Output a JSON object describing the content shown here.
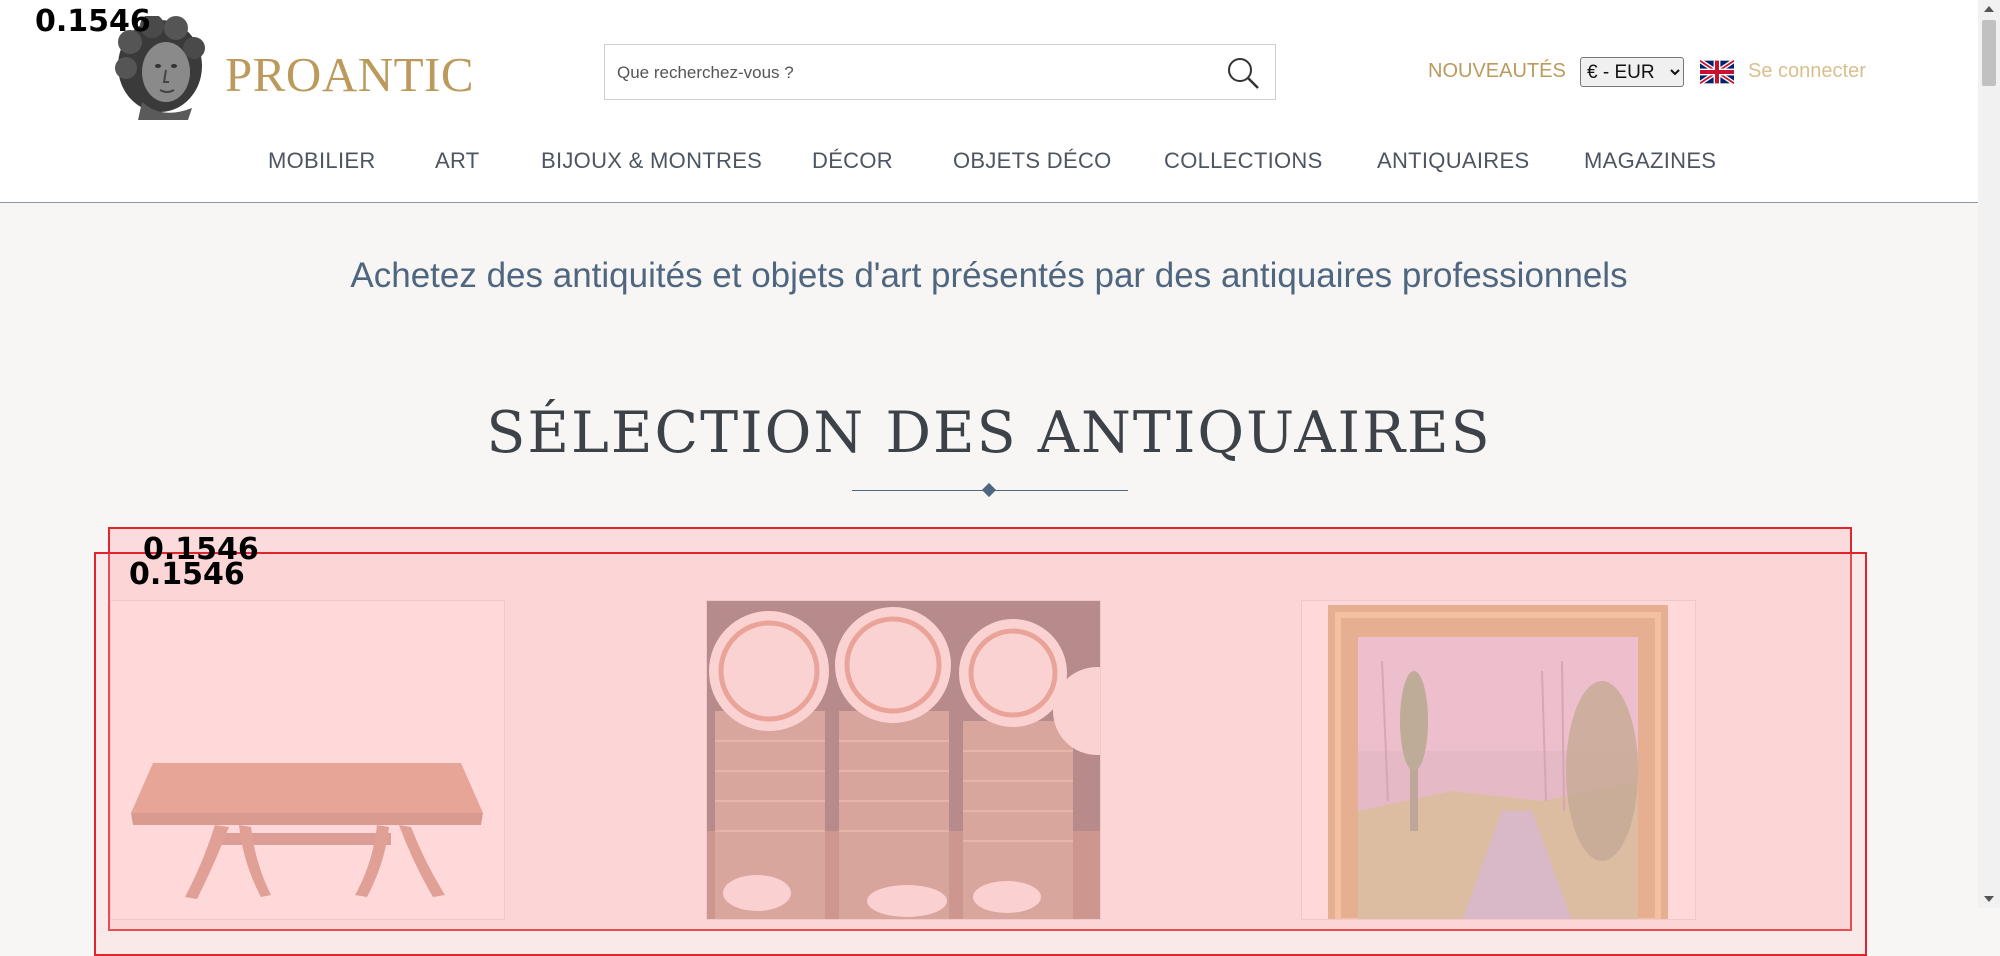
{
  "header": {
    "logo_text": "PROANTIC",
    "search": {
      "placeholder": "Que recherchez-vous ?"
    },
    "nouveautes_label": "NOUVEAUTÉS",
    "currency": {
      "selected": "€ - EUR"
    },
    "login_label": "Se connecter",
    "nav": [
      {
        "label": "MOBILIER"
      },
      {
        "label": "ART"
      },
      {
        "label": "BIJOUX & MONTRES"
      },
      {
        "label": "DÉCOR"
      },
      {
        "label": "OBJETS DÉCO"
      },
      {
        "label": "COLLECTIONS"
      },
      {
        "label": "ANTIQUAIRES"
      },
      {
        "label": "MAGAZINES"
      }
    ]
  },
  "main": {
    "tagline": "Achetez des antiquités et objets d'art présentés par des antiquaires professionnels",
    "section_title": "SÉLECTION DES ANTIQUAIRES",
    "products": [
      {
        "image": "wooden-table"
      },
      {
        "image": "porcelain-plates"
      },
      {
        "image": "framed-painting"
      }
    ]
  },
  "overlay": {
    "scores": [
      "0.1546",
      "0.1546",
      "0.1546"
    ]
  },
  "colors": {
    "accent_gold": "#bb9a5c",
    "nav_text": "#4d5560",
    "tagline_blue": "#4f6680",
    "overlay_red": "#e0262b"
  }
}
